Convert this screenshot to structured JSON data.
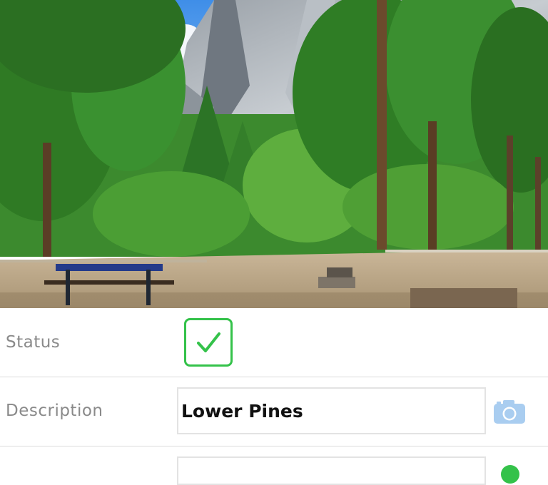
{
  "photo": {
    "subject": "forest-campground-photo"
  },
  "form": {
    "status": {
      "label": "Status",
      "checked": true
    },
    "description": {
      "label": "Description",
      "value": "Lower Pines"
    },
    "third_row": {
      "label": "",
      "value": ""
    }
  },
  "colors": {
    "accent_green": "#34c24a",
    "camera_blue": "#a9cdf0",
    "label_gray": "#8a8a8a"
  },
  "icons": {
    "status": "checkmark-icon",
    "description_action": "camera-icon"
  }
}
